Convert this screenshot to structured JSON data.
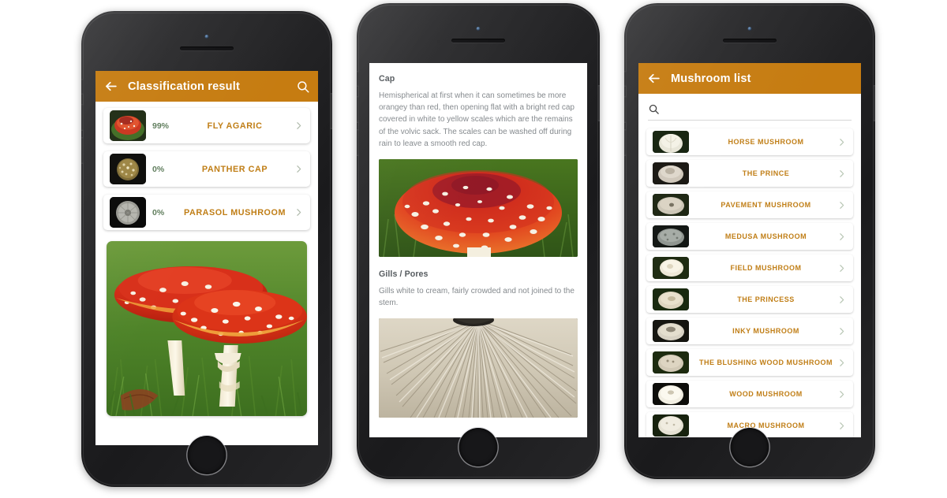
{
  "phone1": {
    "appbar": {
      "title": "Classification result",
      "back_icon": "arrow-left-icon",
      "search_icon": "search-icon"
    },
    "results": [
      {
        "percent": "99%",
        "name": "FLY AGARIC",
        "thumb": "fly-agaric-thumb"
      },
      {
        "percent": "0%",
        "name": "PANTHER CAP",
        "thumb": "panther-cap-thumb"
      },
      {
        "percent": "0%",
        "name": "PARASOL MUSHROOM",
        "thumb": "parasol-mushroom-thumb"
      }
    ],
    "hero_image": "fly-agaric-photo"
  },
  "phone2": {
    "sections": [
      {
        "heading": "Cap",
        "text": "Hemispherical at first when it can sometimes be more orangey than red, then opening flat with a bright red cap covered in white to yellow scales which are the remains of the volvic sack. The scales can be washed off during rain to leave a smooth red cap.",
        "image": "red-cap-photo"
      },
      {
        "heading": "Gills / Pores",
        "text": "Gills white to cream, fairly crowded and not joined to the stem.",
        "image": "gills-closeup-photo"
      }
    ]
  },
  "phone3": {
    "appbar": {
      "title": "Mushroom list",
      "back_icon": "arrow-left-icon"
    },
    "search": {
      "value": "",
      "placeholder": "",
      "icon": "search-icon"
    },
    "items": [
      {
        "name": "HORSE MUSHROOM"
      },
      {
        "name": "THE PRINCE"
      },
      {
        "name": "PAVEMENT MUSHROOM"
      },
      {
        "name": "MEDUSA MUSHROOM"
      },
      {
        "name": "FIELD MUSHROOM"
      },
      {
        "name": "THE PRINCESS"
      },
      {
        "name": "INKY MUSHROOM"
      },
      {
        "name": "THE BLUSHING WOOD MUSHROOM"
      },
      {
        "name": "WOOD MUSHROOM"
      },
      {
        "name": "MACRO MUSHROOM"
      }
    ]
  },
  "colors": {
    "appbar": "#c67c11",
    "accent_name": "#c07e16",
    "percent": "#5f7d5c",
    "body_text": "#84898d",
    "heading": "#555a5e",
    "page_background": "#ffffff"
  }
}
